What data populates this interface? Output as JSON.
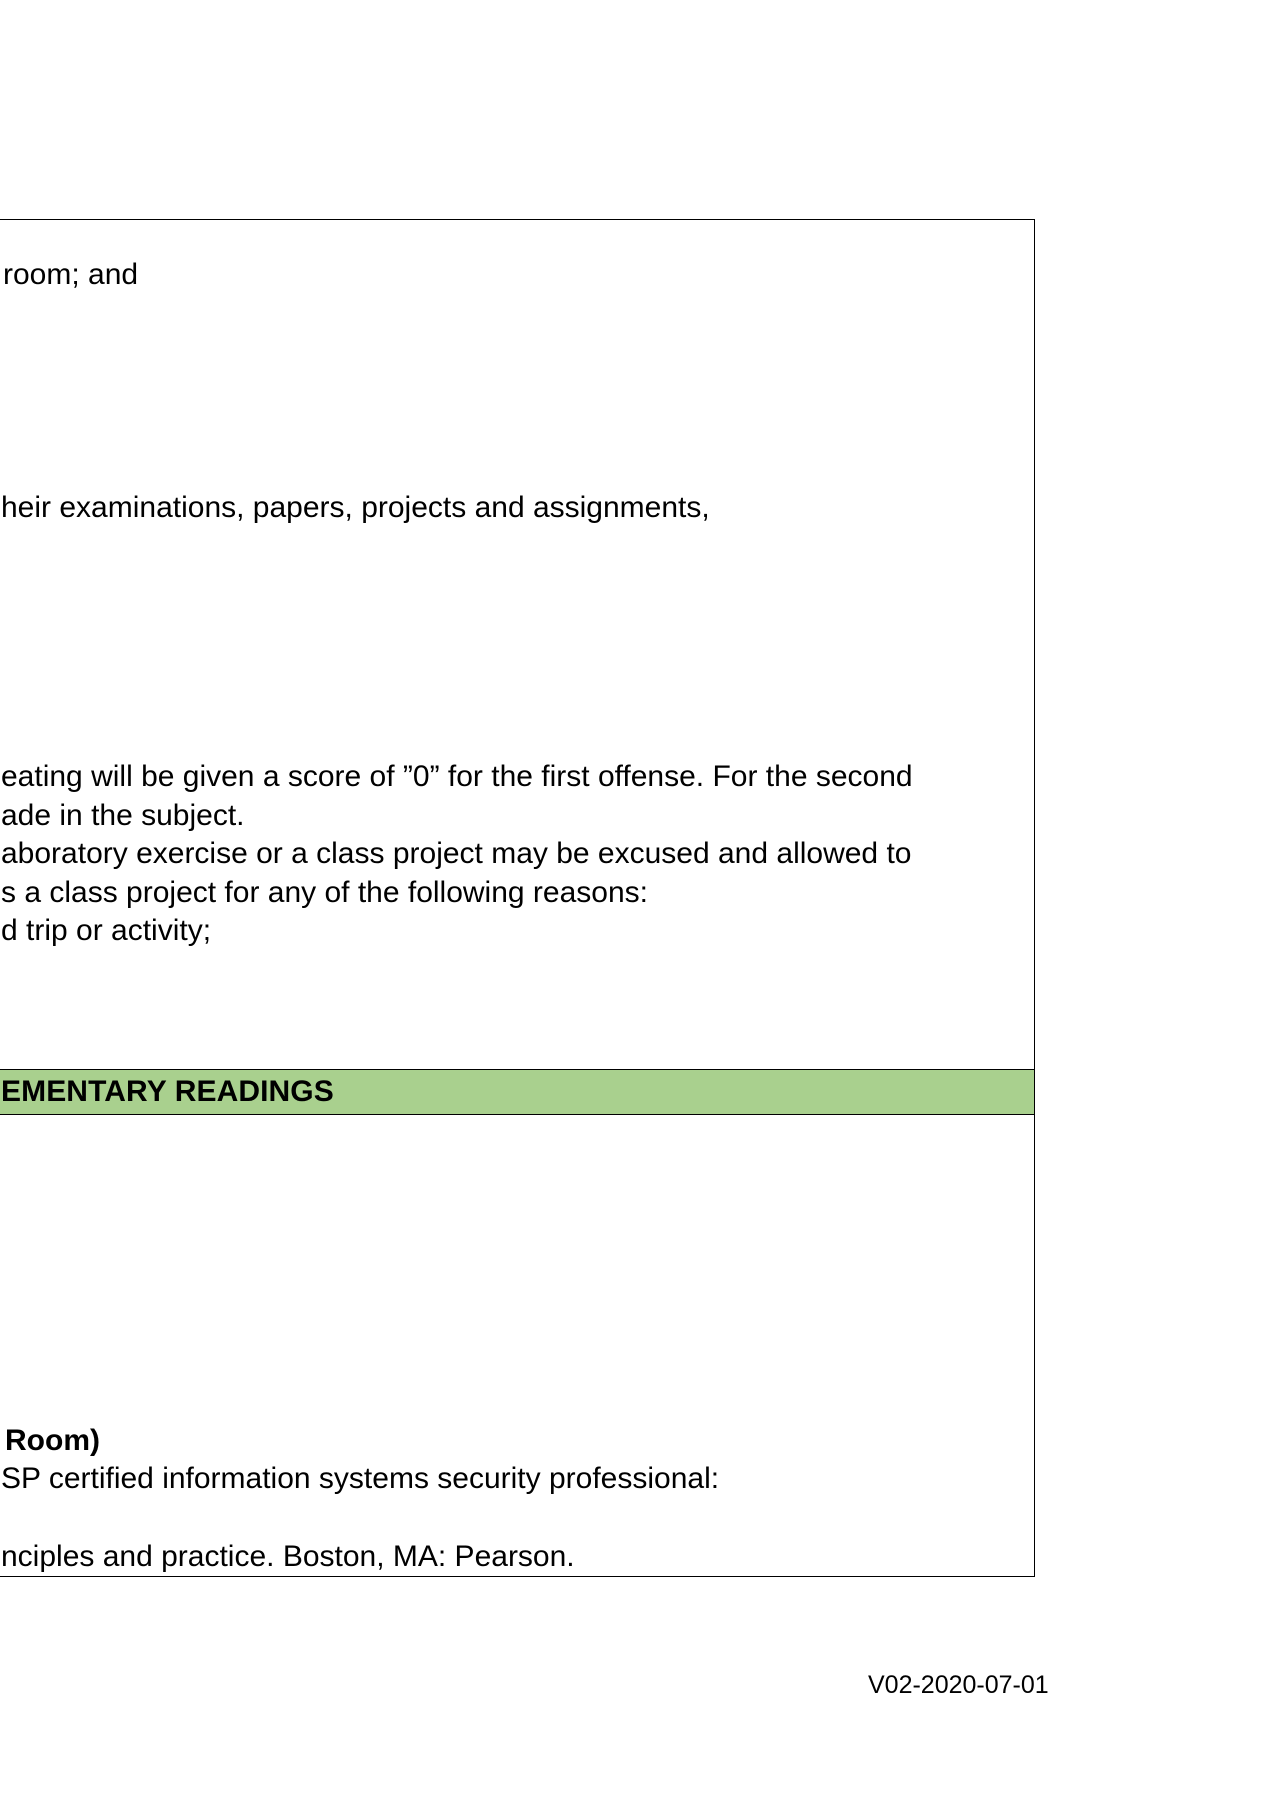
{
  "policy_section": {
    "lines": [
      "room; and",
      "heir examinations, papers, projects and assignments,",
      "eating will be given a score of ”0” for the first offense. For the second",
      "ade in the subject.",
      "aboratory exercise or a class project may be excused and allowed to",
      "s a class project for any of the following reasons:",
      "d trip or activity;"
    ]
  },
  "readings_section": {
    "header": "EMENTARY READINGS",
    "lines": [
      "Room)",
      "SP certified information systems security professional:",
      "nciples and practice. Boston, MA: Pearson."
    ]
  },
  "footer": {
    "version": "V02-2020-07-01"
  },
  "colors": {
    "header_background": "#a9d08e",
    "border": "#000000"
  }
}
